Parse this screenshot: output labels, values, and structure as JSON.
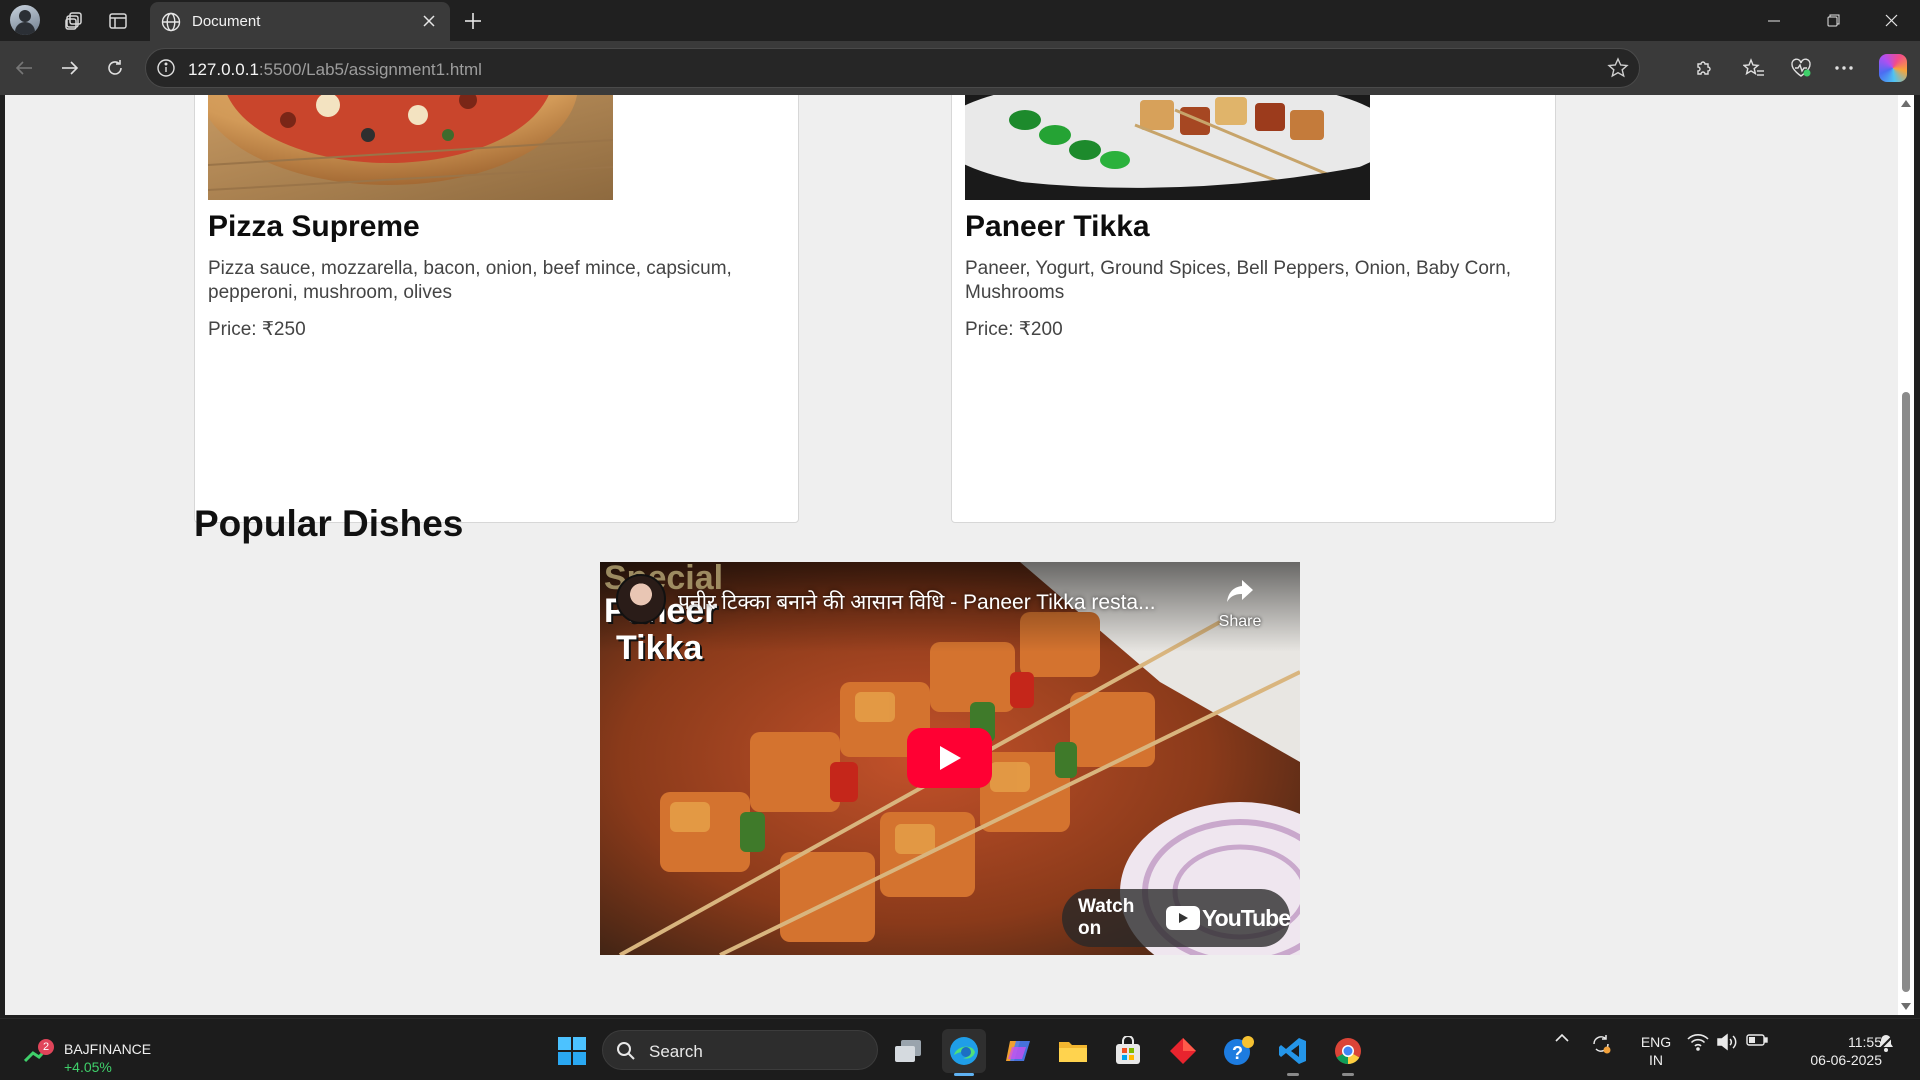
{
  "browser": {
    "tab_title": "Document",
    "url_host": "127.0.0.1",
    "url_path": ":5500/Lab5/assignment1.html"
  },
  "page": {
    "cards": [
      {
        "name": "Pizza Supreme",
        "description": "Pizza sauce, mozzarella, bacon, onion, beef mince, capsicum, pepperoni, mushroom, olives",
        "price": "Price: ₹250"
      },
      {
        "name": "Paneer Tikka",
        "description": "Paneer, Yogurt, Ground Spices, Bell Peppers, Onion, Baby Corn, Mushrooms",
        "price": "Price: ₹200"
      }
    ],
    "section_title": "Popular Dishes",
    "video": {
      "title": "पनीर टिक्का बनाने की आसान विधि - Paneer Tikka resta...",
      "thumb_line1": "Special",
      "thumb_line2": "Paneer",
      "thumb_line3": "Tikka",
      "share_label": "Share",
      "watch_on_label": "Watch on",
      "youtube_word": "YouTube"
    }
  },
  "taskbar": {
    "stock_badge": "2",
    "stock_ticker": "BAJFINANCE",
    "stock_change": "+4.05%",
    "search_label": "Search",
    "lang_line1": "ENG",
    "lang_line2": "IN",
    "time": "11:55",
    "date": "06-06-2025"
  },
  "colors": {
    "page_bg": "#efefef",
    "youtube_red": "#ff0033",
    "stock_green": "#3fcf6a"
  }
}
